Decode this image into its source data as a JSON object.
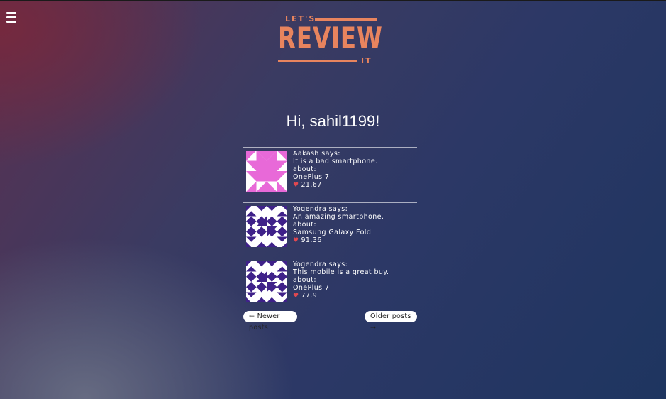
{
  "logo": {
    "lets": "LET'S",
    "review": "REVIEW",
    "it": "IT"
  },
  "greeting": "Hi, sahil1199!",
  "posts": [
    {
      "author_line": "Aakash says:",
      "text": "It is a bad smartphone.",
      "about_label": "about:",
      "product": "OnePlus 7",
      "score": "21.67",
      "avatar_icon": "identicon-pink"
    },
    {
      "author_line": "Yogendra says:",
      "text": "An amazing smartphone.",
      "about_label": "about:",
      "product": "Samsung Galaxy Fold",
      "score": "91.36",
      "avatar_icon": "identicon-purple"
    },
    {
      "author_line": "Yogendra says:",
      "text": "This mobile is a great buy.",
      "about_label": "about:",
      "product": "OnePlus 7",
      "score": "77.9",
      "avatar_icon": "identicon-purple"
    }
  ],
  "pagination": {
    "newer_label": "← Newer posts",
    "older_label": "Older posts →"
  },
  "colors": {
    "accent": "#e8845e",
    "heart": "#e34850",
    "identicon_pink": "#e869d8",
    "identicon_purple": "#3f2189"
  }
}
